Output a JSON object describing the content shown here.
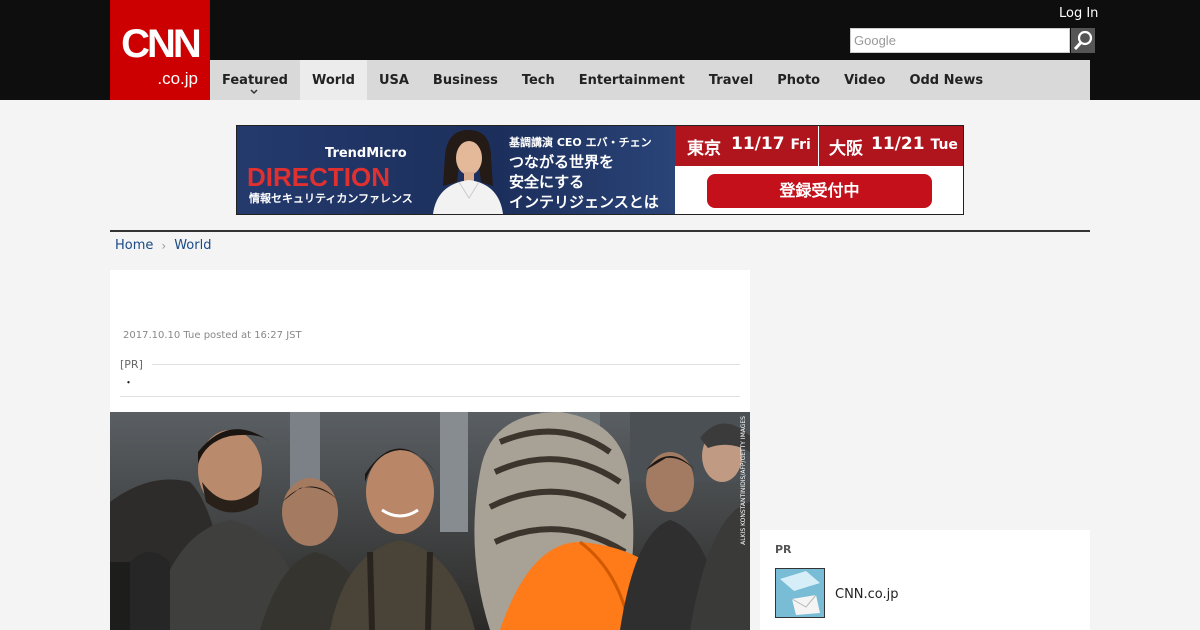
{
  "header": {
    "logo_main": "CNN",
    "logo_sub": ".co.jp",
    "login": "Log In",
    "search_placeholder": "Google"
  },
  "nav": {
    "items": [
      {
        "label": "Featured"
      },
      {
        "label": "World"
      },
      {
        "label": "USA"
      },
      {
        "label": "Business"
      },
      {
        "label": "Tech"
      },
      {
        "label": "Entertainment"
      },
      {
        "label": "Travel"
      },
      {
        "label": "Photo"
      },
      {
        "label": "Video"
      },
      {
        "label": "Odd News"
      }
    ],
    "active": "World"
  },
  "banner": {
    "brand": "TrendMicro",
    "event": "DIRECTION",
    "conference": "情報セキュリティカンファレンス",
    "speaker": "基調講演 CEO エバ・チェン",
    "copy_1": "つながる世界を",
    "copy_2": "安全にする",
    "copy_3": "インテリジェンスとは",
    "tokyo_city": "東京",
    "tokyo_date": "11/17",
    "tokyo_day": "Fri",
    "osaka_city": "大阪",
    "osaka_date": "11/21",
    "osaka_day": "Tue",
    "register": "登録受付中",
    "accent": "#c4101b"
  },
  "breadcrumb": {
    "home": "Home",
    "section": "World"
  },
  "article": {
    "posted": "2017.10.10 Tue posted at 16:27 JST",
    "pr_label": "[PR]",
    "pr_text": "・",
    "photo_credit": "ALKIS KONSTANTINIDIS/AFP/GETTY IMAGES"
  },
  "sidebar_pr": {
    "title": "PR",
    "name": "CNN.co.jp"
  }
}
